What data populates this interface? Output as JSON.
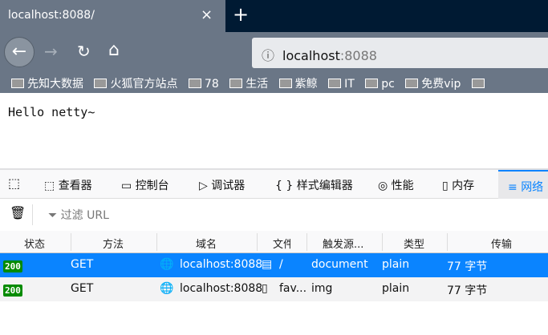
{
  "tab": {
    "title": "localhost:8088/",
    "close": "×",
    "new_tab": "+"
  },
  "nav": {
    "back": "←",
    "forward": "→",
    "reload": "↻",
    "home": "⌂",
    "info": "ⓘ",
    "url_host": "localhost",
    "url_port": ":8088"
  },
  "bookmarks": [
    "先知大数据",
    "火狐官方站点",
    "78",
    "生活",
    "紫鲸",
    "IT",
    "pc",
    "免费vip"
  ],
  "page": {
    "text": "Hello netty~"
  },
  "devtools": {
    "tabs": [
      {
        "icon": "⬚",
        "label": "查看器"
      },
      {
        "icon": "▭",
        "label": "控制台"
      },
      {
        "icon": "▷",
        "label": "调试器"
      },
      {
        "icon": "{ }",
        "label": "样式编辑器"
      },
      {
        "icon": "◎",
        "label": "性能"
      },
      {
        "icon": "▯",
        "label": "内存"
      },
      {
        "icon": "≡",
        "label": "网络"
      }
    ],
    "filter_placeholder": "过滤 URL",
    "columns": [
      "状态",
      "方法",
      "域名",
      "文件",
      "触发源...",
      "类型",
      "传输"
    ],
    "rows": [
      {
        "status": "200",
        "method": "GET",
        "domain": "localhost:8088",
        "file": "/",
        "cause": "document",
        "type": "plain",
        "transferred": "77 字节"
      },
      {
        "status": "200",
        "method": "GET",
        "domain": "localhost:8088",
        "file": "fav...",
        "cause": "img",
        "type": "plain",
        "transferred": "77 字节"
      }
    ]
  },
  "colors": {
    "chrome": "#6a7686",
    "tabbar_dark": "#001a33",
    "selected_row": "#0a84ff",
    "status_ok": "#058b00"
  }
}
